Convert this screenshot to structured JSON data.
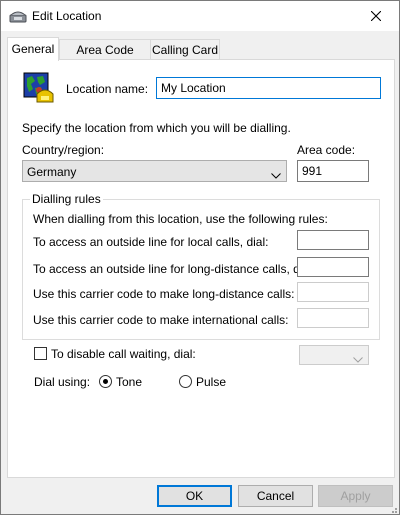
{
  "window": {
    "title": "Edit Location"
  },
  "tabs": [
    {
      "label": "General",
      "active": true
    },
    {
      "label": "Area Code Rules",
      "active": false
    },
    {
      "label": "Calling Card",
      "active": false
    }
  ],
  "general": {
    "location_name_label": "Location name:",
    "location_name_value": "My Location",
    "specify_text": "Specify the location from which you will be dialling.",
    "country_label": "Country/region:",
    "country_value": "Germany",
    "area_code_label": "Area code:",
    "area_code_value": "991",
    "dialling_rules": {
      "title": "Dialling rules",
      "intro": "When dialling from this location, use the following rules:",
      "local_label": "To access an outside line for local calls, dial:",
      "local_value": "",
      "long_distance_label": "To access an outside line for long-distance calls, dial:",
      "long_distance_value": "",
      "carrier_long_label": "Use this carrier code to make long-distance calls:",
      "carrier_long_value": "",
      "carrier_intl_label": "Use this carrier code to make international calls:",
      "carrier_intl_value": ""
    },
    "call_waiting_label": "To disable call waiting, dial:",
    "call_waiting_checked": false,
    "call_waiting_value": "",
    "dial_using_label": "Dial using:",
    "tone_label": "Tone",
    "pulse_label": "Pulse",
    "selected_dial_mode": "Tone"
  },
  "buttons": {
    "ok": "OK",
    "cancel": "Cancel",
    "apply": "Apply"
  },
  "colors": {
    "accent": "#0078d7",
    "panel": "#ffffff",
    "dialog": "#f0f0f0"
  }
}
